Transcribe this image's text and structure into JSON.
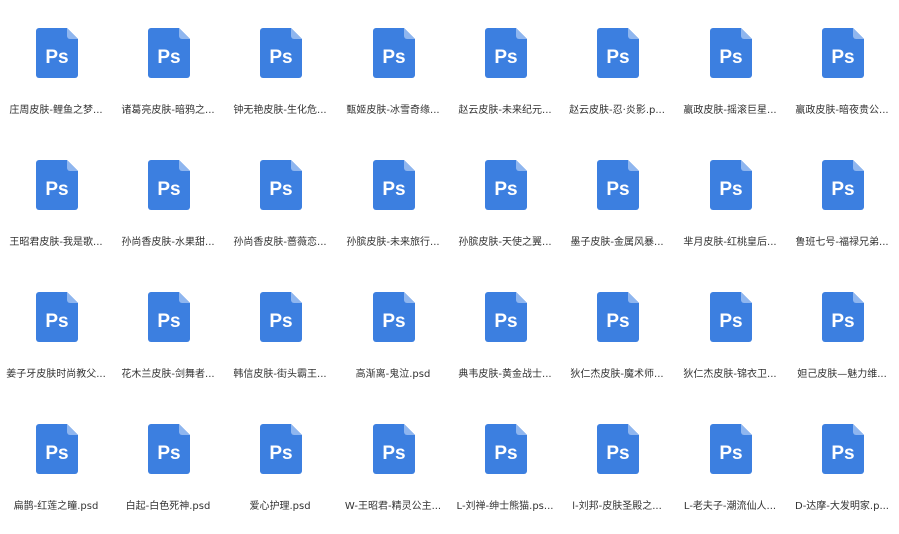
{
  "icon": {
    "name": "photoshop-file-icon",
    "label": "Ps",
    "color": "#3c7fe0",
    "fold_color": "#8fb6ef"
  },
  "files": [
    "庄周皮肤-鲤鱼之梦...",
    "诸葛亮皮肤-暗鸦之...",
    "钟无艳皮肤-生化危...",
    "甄姬皮肤-冰雪奇缘...",
    "赵云皮肤-未来纪元...",
    "赵云皮肤-忍·炎影.p...",
    "嬴政皮肤-摇滚巨星...",
    "嬴政皮肤-暗夜贵公...",
    "王昭君皮肤-我是歌...",
    "孙尚香皮肤-水果甜...",
    "孙尚香皮肤-蔷薇恋...",
    "孙膑皮肤-未来旅行...",
    "孙膑皮肤-天使之翼...",
    "墨子皮肤-金属风暴...",
    "芈月皮肤-红桃皇后...",
    "鲁班七号-福禄兄弟...",
    "姜子牙皮肤时尚教父...",
    "花木兰皮肤-剑舞者...",
    "韩信皮肤-街头霸王...",
    "高渐离-鬼泣.psd",
    "典韦皮肤-黄金战士...",
    "狄仁杰皮肤-魔术师...",
    "狄仁杰皮肤-锦衣卫...",
    "妲己皮肤—魅力维...",
    "扁鹊-红莲之瞳.psd",
    "白起-白色死神.psd",
    "爱心护理.psd",
    "W-王昭君-精灵公主...",
    "L-刘禅-绅士熊猫.ps...",
    "l-刘邦-皮肤圣殿之...",
    "L-老夫子-潮流仙人...",
    "D-达摩-大发明家.p..."
  ]
}
